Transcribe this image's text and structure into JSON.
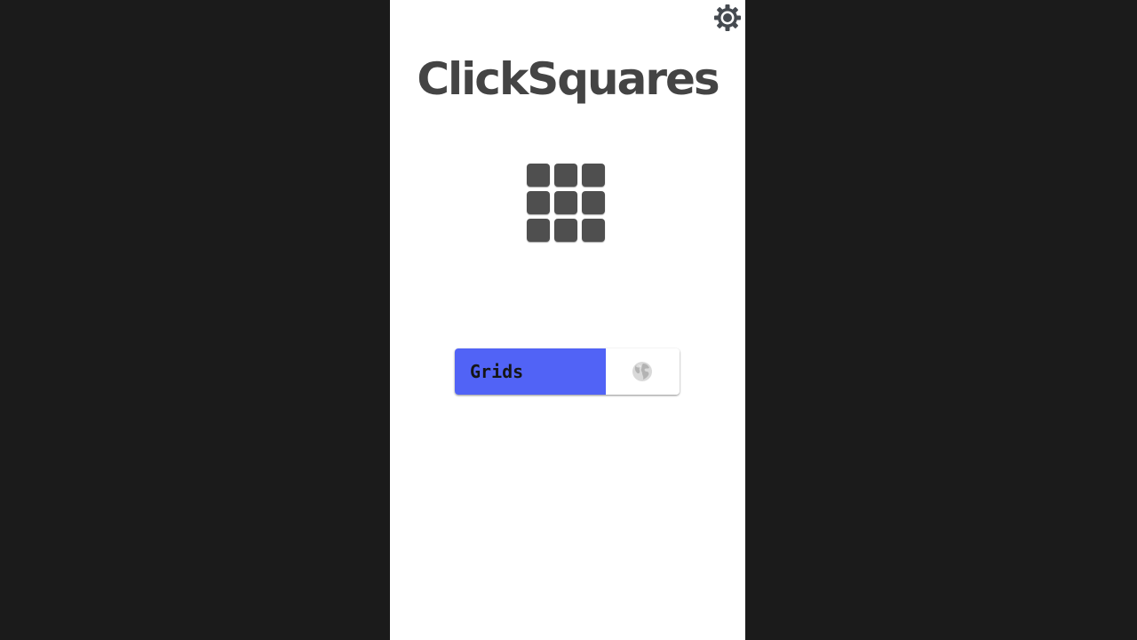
{
  "app": {
    "title": "ClickSquares"
  },
  "header": {
    "settings_icon": "gear-icon"
  },
  "logo": {
    "icon": "grid-3x3-icon",
    "rows": 3,
    "cols": 3,
    "square_color": "#4f4f4f"
  },
  "mode_switch": {
    "grids_label": "Grids",
    "grids_color": "#5163f6",
    "online_icon": "globe-icon"
  },
  "colors": {
    "background": "#1b1b1b",
    "screen": "#ffffff",
    "title": "#444444",
    "accent": "#5163f6"
  }
}
